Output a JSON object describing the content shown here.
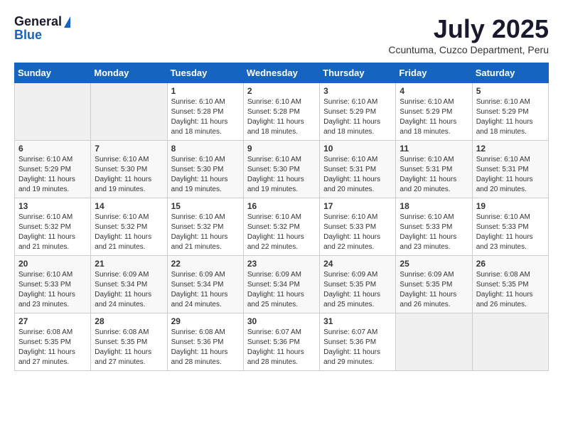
{
  "header": {
    "logo_general": "General",
    "logo_blue": "Blue",
    "month_title": "July 2025",
    "location": "Ccuntuma, Cuzco Department, Peru"
  },
  "weekdays": [
    "Sunday",
    "Monday",
    "Tuesday",
    "Wednesday",
    "Thursday",
    "Friday",
    "Saturday"
  ],
  "weeks": [
    [
      {
        "day": "",
        "info": ""
      },
      {
        "day": "",
        "info": ""
      },
      {
        "day": "1",
        "info": "Sunrise: 6:10 AM\nSunset: 5:28 PM\nDaylight: 11 hours and 18 minutes."
      },
      {
        "day": "2",
        "info": "Sunrise: 6:10 AM\nSunset: 5:28 PM\nDaylight: 11 hours and 18 minutes."
      },
      {
        "day": "3",
        "info": "Sunrise: 6:10 AM\nSunset: 5:29 PM\nDaylight: 11 hours and 18 minutes."
      },
      {
        "day": "4",
        "info": "Sunrise: 6:10 AM\nSunset: 5:29 PM\nDaylight: 11 hours and 18 minutes."
      },
      {
        "day": "5",
        "info": "Sunrise: 6:10 AM\nSunset: 5:29 PM\nDaylight: 11 hours and 18 minutes."
      }
    ],
    [
      {
        "day": "6",
        "info": "Sunrise: 6:10 AM\nSunset: 5:29 PM\nDaylight: 11 hours and 19 minutes."
      },
      {
        "day": "7",
        "info": "Sunrise: 6:10 AM\nSunset: 5:30 PM\nDaylight: 11 hours and 19 minutes."
      },
      {
        "day": "8",
        "info": "Sunrise: 6:10 AM\nSunset: 5:30 PM\nDaylight: 11 hours and 19 minutes."
      },
      {
        "day": "9",
        "info": "Sunrise: 6:10 AM\nSunset: 5:30 PM\nDaylight: 11 hours and 19 minutes."
      },
      {
        "day": "10",
        "info": "Sunrise: 6:10 AM\nSunset: 5:31 PM\nDaylight: 11 hours and 20 minutes."
      },
      {
        "day": "11",
        "info": "Sunrise: 6:10 AM\nSunset: 5:31 PM\nDaylight: 11 hours and 20 minutes."
      },
      {
        "day": "12",
        "info": "Sunrise: 6:10 AM\nSunset: 5:31 PM\nDaylight: 11 hours and 20 minutes."
      }
    ],
    [
      {
        "day": "13",
        "info": "Sunrise: 6:10 AM\nSunset: 5:32 PM\nDaylight: 11 hours and 21 minutes."
      },
      {
        "day": "14",
        "info": "Sunrise: 6:10 AM\nSunset: 5:32 PM\nDaylight: 11 hours and 21 minutes."
      },
      {
        "day": "15",
        "info": "Sunrise: 6:10 AM\nSunset: 5:32 PM\nDaylight: 11 hours and 21 minutes."
      },
      {
        "day": "16",
        "info": "Sunrise: 6:10 AM\nSunset: 5:32 PM\nDaylight: 11 hours and 22 minutes."
      },
      {
        "day": "17",
        "info": "Sunrise: 6:10 AM\nSunset: 5:33 PM\nDaylight: 11 hours and 22 minutes."
      },
      {
        "day": "18",
        "info": "Sunrise: 6:10 AM\nSunset: 5:33 PM\nDaylight: 11 hours and 23 minutes."
      },
      {
        "day": "19",
        "info": "Sunrise: 6:10 AM\nSunset: 5:33 PM\nDaylight: 11 hours and 23 minutes."
      }
    ],
    [
      {
        "day": "20",
        "info": "Sunrise: 6:10 AM\nSunset: 5:33 PM\nDaylight: 11 hours and 23 minutes."
      },
      {
        "day": "21",
        "info": "Sunrise: 6:09 AM\nSunset: 5:34 PM\nDaylight: 11 hours and 24 minutes."
      },
      {
        "day": "22",
        "info": "Sunrise: 6:09 AM\nSunset: 5:34 PM\nDaylight: 11 hours and 24 minutes."
      },
      {
        "day": "23",
        "info": "Sunrise: 6:09 AM\nSunset: 5:34 PM\nDaylight: 11 hours and 25 minutes."
      },
      {
        "day": "24",
        "info": "Sunrise: 6:09 AM\nSunset: 5:35 PM\nDaylight: 11 hours and 25 minutes."
      },
      {
        "day": "25",
        "info": "Sunrise: 6:09 AM\nSunset: 5:35 PM\nDaylight: 11 hours and 26 minutes."
      },
      {
        "day": "26",
        "info": "Sunrise: 6:08 AM\nSunset: 5:35 PM\nDaylight: 11 hours and 26 minutes."
      }
    ],
    [
      {
        "day": "27",
        "info": "Sunrise: 6:08 AM\nSunset: 5:35 PM\nDaylight: 11 hours and 27 minutes."
      },
      {
        "day": "28",
        "info": "Sunrise: 6:08 AM\nSunset: 5:35 PM\nDaylight: 11 hours and 27 minutes."
      },
      {
        "day": "29",
        "info": "Sunrise: 6:08 AM\nSunset: 5:36 PM\nDaylight: 11 hours and 28 minutes."
      },
      {
        "day": "30",
        "info": "Sunrise: 6:07 AM\nSunset: 5:36 PM\nDaylight: 11 hours and 28 minutes."
      },
      {
        "day": "31",
        "info": "Sunrise: 6:07 AM\nSunset: 5:36 PM\nDaylight: 11 hours and 29 minutes."
      },
      {
        "day": "",
        "info": ""
      },
      {
        "day": "",
        "info": ""
      }
    ]
  ]
}
